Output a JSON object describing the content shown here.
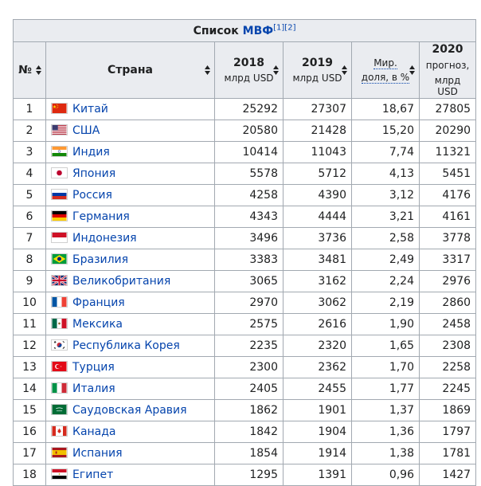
{
  "caption": {
    "text": "Список ",
    "link": "МВФ",
    "refs": "[1][2]"
  },
  "headers": {
    "rank": "№",
    "country": "Страна",
    "y2018": {
      "top": "2018",
      "bottom": "млрд USD"
    },
    "y2019": {
      "top": "2019",
      "bottom": "млрд USD"
    },
    "share": {
      "top": "Мир.",
      "bottom": "доля, в %"
    },
    "y2020": {
      "top": "2020",
      "mid": "прогноз,",
      "bottom": "млрд USD"
    }
  },
  "rows": [
    {
      "rank": "1",
      "country": "Китай",
      "flag": "china",
      "y2018": "25292",
      "y2019": "27307",
      "share": "18,67",
      "y2020": "27805"
    },
    {
      "rank": "2",
      "country": "США",
      "flag": "usa",
      "y2018": "20580",
      "y2019": "21428",
      "share": "15,20",
      "y2020": "20290"
    },
    {
      "rank": "3",
      "country": "Индия",
      "flag": "india",
      "y2018": "10414",
      "y2019": "11043",
      "share": "7,74",
      "y2020": "11321"
    },
    {
      "rank": "4",
      "country": "Япония",
      "flag": "japan",
      "y2018": "5578",
      "y2019": "5712",
      "share": "4,13",
      "y2020": "5451"
    },
    {
      "rank": "5",
      "country": "Россия",
      "flag": "russia",
      "y2018": "4258",
      "y2019": "4390",
      "share": "3,12",
      "y2020": "4176"
    },
    {
      "rank": "6",
      "country": "Германия",
      "flag": "germany",
      "y2018": "4343",
      "y2019": "4444",
      "share": "3,21",
      "y2020": "4161"
    },
    {
      "rank": "7",
      "country": "Индонезия",
      "flag": "indonesia",
      "y2018": "3496",
      "y2019": "3736",
      "share": "2,58",
      "y2020": "3778"
    },
    {
      "rank": "8",
      "country": "Бразилия",
      "flag": "brazil",
      "y2018": "3383",
      "y2019": "3481",
      "share": "2,49",
      "y2020": "3317"
    },
    {
      "rank": "9",
      "country": "Великобритания",
      "flag": "uk",
      "y2018": "3065",
      "y2019": "3162",
      "share": "2,24",
      "y2020": "2976"
    },
    {
      "rank": "10",
      "country": "Франция",
      "flag": "france",
      "y2018": "2970",
      "y2019": "3062",
      "share": "2,19",
      "y2020": "2860"
    },
    {
      "rank": "11",
      "country": "Мексика",
      "flag": "mexico",
      "y2018": "2575",
      "y2019": "2616",
      "share": "1,90",
      "y2020": "2458"
    },
    {
      "rank": "12",
      "country": "Республика Корея",
      "flag": "korea",
      "y2018": "2235",
      "y2019": "2320",
      "share": "1,65",
      "y2020": "2308"
    },
    {
      "rank": "13",
      "country": "Турция",
      "flag": "turkey",
      "y2018": "2300",
      "y2019": "2362",
      "share": "1,70",
      "y2020": "2258"
    },
    {
      "rank": "14",
      "country": "Италия",
      "flag": "italy",
      "y2018": "2405",
      "y2019": "2455",
      "share": "1,77",
      "y2020": "2245"
    },
    {
      "rank": "15",
      "country": "Саудовская Аравия",
      "flag": "saudi-arabia",
      "y2018": "1862",
      "y2019": "1901",
      "share": "1,37",
      "y2020": "1869"
    },
    {
      "rank": "16",
      "country": "Канада",
      "flag": "canada",
      "y2018": "1842",
      "y2019": "1904",
      "share": "1,36",
      "y2020": "1797"
    },
    {
      "rank": "17",
      "country": "Испания",
      "flag": "spain",
      "y2018": "1854",
      "y2019": "1914",
      "share": "1,38",
      "y2020": "1781"
    },
    {
      "rank": "18",
      "country": "Египет",
      "flag": "egypt",
      "y2018": "1295",
      "y2019": "1391",
      "share": "0,96",
      "y2020": "1427"
    }
  ],
  "colors": {
    "link": "#0645ad",
    "header_bg": "#eaecf0",
    "border": "#a2a9b1"
  }
}
